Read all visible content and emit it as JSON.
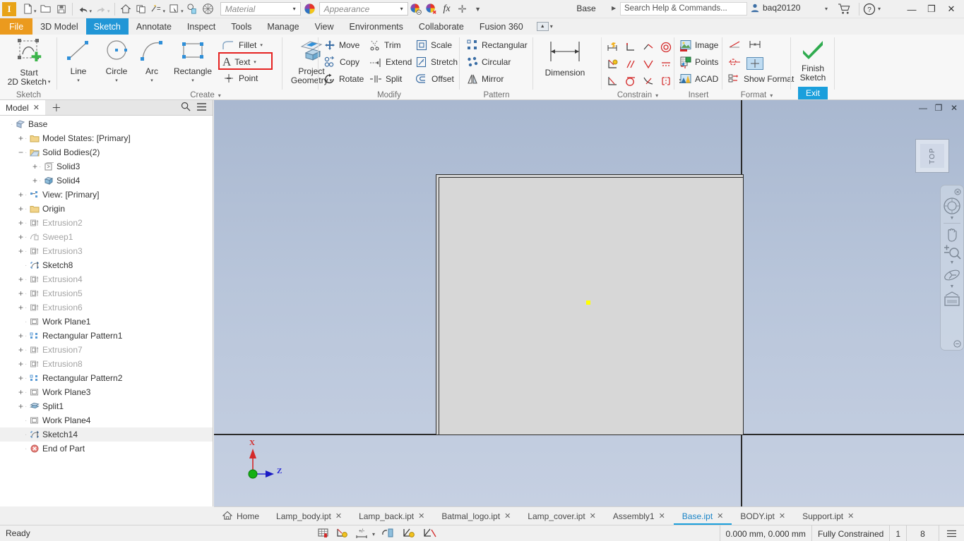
{
  "titlebar": {
    "logo_letter": "I",
    "quick_access": [
      {
        "name": "new-document-icon",
        "label": "New"
      },
      {
        "name": "open-document-icon",
        "label": "Open"
      },
      {
        "name": "save-icon",
        "label": "Save"
      },
      {
        "name": "undo-icon",
        "label": "Undo"
      },
      {
        "name": "redo-icon",
        "label": "Redo"
      },
      {
        "name": "home-icon",
        "label": "Home"
      },
      {
        "name": "return-icon",
        "label": "Return"
      },
      {
        "name": "update-icon",
        "label": "Update"
      },
      {
        "name": "select-icon",
        "label": "Select"
      },
      {
        "name": "parameters-icon",
        "label": "Parameters"
      },
      {
        "name": "material-sphere-icon",
        "label": "Material Sphere"
      }
    ],
    "material_placeholder": "Material",
    "appearance_placeholder": "Appearance",
    "fx_label": "fx",
    "document_title": "Base",
    "search_placeholder": "Search Help & Commands...",
    "user_name": "baq20120",
    "minimize": "—",
    "restore": "❐",
    "close": "✕"
  },
  "ribbon_tabs": [
    {
      "label": "File",
      "state": "file"
    },
    {
      "label": "3D Model",
      "state": "normal"
    },
    {
      "label": "Sketch",
      "state": "active"
    },
    {
      "label": "Annotate",
      "state": "normal"
    },
    {
      "label": "Inspect",
      "state": "normal"
    },
    {
      "label": "Tools",
      "state": "normal"
    },
    {
      "label": "Manage",
      "state": "normal"
    },
    {
      "label": "View",
      "state": "normal"
    },
    {
      "label": "Environments",
      "state": "normal"
    },
    {
      "label": "Collaborate",
      "state": "normal"
    },
    {
      "label": "Fusion 360",
      "state": "normal"
    }
  ],
  "ribbon": {
    "panels": {
      "sketch": {
        "label": "Sketch",
        "start_2d_sketch_line1": "Start",
        "start_2d_sketch_line2": "2D Sketch"
      },
      "create": {
        "label": "Create",
        "line": "Line",
        "circle": "Circle",
        "arc": "Arc",
        "rectangle": "Rectangle",
        "fillet": "Fillet",
        "text": "Text",
        "point": "Point",
        "project_geometry_line1": "Project",
        "project_geometry_line2": "Geometry"
      },
      "modify": {
        "label": "Modify",
        "move": "Move",
        "copy": "Copy",
        "rotate": "Rotate",
        "trim": "Trim",
        "extend": "Extend",
        "split": "Split",
        "scale": "Scale",
        "stretch": "Stretch",
        "offset": "Offset"
      },
      "pattern": {
        "label": "Pattern",
        "rectangular": "Rectangular",
        "circular": "Circular",
        "mirror": "Mirror"
      },
      "constrain": {
        "label": "Constrain",
        "dimension": "Dimension"
      },
      "insert": {
        "label": "Insert",
        "image": "Image",
        "points": "Points",
        "acad": "ACAD"
      },
      "format": {
        "label": "Format",
        "show_format": "Show Format"
      },
      "exit": {
        "finish_sketch_line1": "Finish",
        "finish_sketch_line2": "Sketch",
        "exit": "Exit"
      }
    },
    "highlight_color": "#e52322"
  },
  "browser": {
    "tab_label": "Model",
    "tab_close": "✕",
    "add_tab": "＋",
    "search_icon": "search-icon",
    "menu_icon": "hamburger-icon",
    "tree": [
      {
        "label": "Base",
        "indent": 0,
        "expander": "",
        "icon": "part-icon",
        "dim": false,
        "selected": false
      },
      {
        "label": "Model States: [Primary]",
        "indent": 1,
        "expander": "+",
        "icon": "folder-icon",
        "dim": false,
        "selected": false
      },
      {
        "label": "Solid Bodies(2)",
        "indent": 1,
        "expander": "−",
        "icon": "folder-open-icon",
        "dim": false,
        "selected": false
      },
      {
        "label": "Solid3",
        "indent": 2,
        "expander": "+",
        "icon": "solid-wire-icon",
        "dim": false,
        "selected": false
      },
      {
        "label": "Solid4",
        "indent": 2,
        "expander": "+",
        "icon": "solid-icon",
        "dim": false,
        "selected": false
      },
      {
        "label": "View: [Primary]",
        "indent": 1,
        "expander": "+",
        "icon": "view-icon",
        "dim": false,
        "selected": false
      },
      {
        "label": "Origin",
        "indent": 1,
        "expander": "+",
        "icon": "folder-icon",
        "dim": false,
        "selected": false
      },
      {
        "label": "Extrusion2",
        "indent": 1,
        "expander": "+",
        "icon": "extrusion-icon",
        "dim": true,
        "selected": false
      },
      {
        "label": "Sweep1",
        "indent": 1,
        "expander": "+",
        "icon": "sweep-icon",
        "dim": true,
        "selected": false
      },
      {
        "label": "Extrusion3",
        "indent": 1,
        "expander": "+",
        "icon": "extrusion-icon",
        "dim": true,
        "selected": false
      },
      {
        "label": "Sketch8",
        "indent": 1,
        "expander": "",
        "icon": "sketch-icon",
        "dim": false,
        "selected": false
      },
      {
        "label": "Extrusion4",
        "indent": 1,
        "expander": "+",
        "icon": "extrusion-icon",
        "dim": true,
        "selected": false
      },
      {
        "label": "Extrusion5",
        "indent": 1,
        "expander": "+",
        "icon": "extrusion-icon",
        "dim": true,
        "selected": false
      },
      {
        "label": "Extrusion6",
        "indent": 1,
        "expander": "+",
        "icon": "extrusion-icon",
        "dim": true,
        "selected": false
      },
      {
        "label": "Work Plane1",
        "indent": 1,
        "expander": "",
        "icon": "workplane-icon",
        "dim": false,
        "selected": false
      },
      {
        "label": "Rectangular Pattern1",
        "indent": 1,
        "expander": "+",
        "icon": "rect-pattern-icon",
        "dim": false,
        "selected": false
      },
      {
        "label": "Extrusion7",
        "indent": 1,
        "expander": "+",
        "icon": "extrusion-icon",
        "dim": true,
        "selected": false
      },
      {
        "label": "Extrusion8",
        "indent": 1,
        "expander": "+",
        "icon": "extrusion-icon",
        "dim": true,
        "selected": false
      },
      {
        "label": "Rectangular Pattern2",
        "indent": 1,
        "expander": "+",
        "icon": "rect-pattern-icon",
        "dim": false,
        "selected": false
      },
      {
        "label": "Work Plane3",
        "indent": 1,
        "expander": "+",
        "icon": "workplane-icon",
        "dim": false,
        "selected": false
      },
      {
        "label": "Split1",
        "indent": 1,
        "expander": "+",
        "icon": "split-icon",
        "dim": false,
        "selected": false
      },
      {
        "label": "Work Plane4",
        "indent": 1,
        "expander": "",
        "icon": "workplane-icon",
        "dim": false,
        "selected": false
      },
      {
        "label": "Sketch14",
        "indent": 1,
        "expander": "",
        "icon": "sketch-icon",
        "dim": false,
        "selected": true
      },
      {
        "label": "End of Part",
        "indent": 1,
        "expander": "",
        "icon": "end-of-part-icon",
        "dim": false,
        "selected": false
      }
    ]
  },
  "graphics": {
    "viewcube_label": "TOP",
    "axis_x_label": "X",
    "axis_z_label": "Z",
    "axis_x_color": "#d42a2a",
    "axis_z_color": "#2a2ad4",
    "axis_origin_color": "#14b014",
    "sketch_point_color": "#ffff00",
    "sketch_face_color": "#d7d7d7",
    "background_top_color": "#a9b8d0",
    "background_bottom_color": "#c6d0e2",
    "window_minimize": "—",
    "window_restore": "❐",
    "window_close": "✕",
    "navbar_items": [
      {
        "name": "navbar-close-icon"
      },
      {
        "name": "full-navigation-wheel-icon"
      },
      {
        "name": "navbar-wheel-dropdown-caret"
      },
      {
        "name": "pan-hand-icon"
      },
      {
        "name": "zoom-magnifier-icon"
      },
      {
        "name": "zoom-dropdown-caret"
      },
      {
        "name": "orbit-icon"
      },
      {
        "name": "orbit-dropdown-caret"
      },
      {
        "name": "look-at-icon"
      },
      {
        "name": "navbar-options-icon"
      }
    ]
  },
  "doc_tabs": [
    {
      "label": "Home",
      "closable": false,
      "active": false,
      "icon": "home-icon"
    },
    {
      "label": "Lamp_body.ipt",
      "closable": true,
      "active": false
    },
    {
      "label": "Lamp_back.ipt",
      "closable": true,
      "active": false
    },
    {
      "label": "Batmal_logo.ipt",
      "closable": true,
      "active": false
    },
    {
      "label": "Lamp_cover.ipt",
      "closable": true,
      "active": false
    },
    {
      "label": "Assembly1",
      "closable": true,
      "active": false
    },
    {
      "label": "Base.ipt",
      "closable": true,
      "active": true
    },
    {
      "label": "BODY.ipt",
      "closable": true,
      "active": false
    },
    {
      "label": "Support.ipt",
      "closable": true,
      "active": false
    }
  ],
  "statusbar": {
    "ready": "Ready",
    "coordinates": "0.000 mm, 0.000 mm",
    "constraint_status": "Fully Constrained",
    "dimensions_count": "1",
    "entities_count": "8",
    "icons": [
      {
        "name": "grid-snap-icon"
      },
      {
        "name": "constraint-inference-icon"
      },
      {
        "name": "dimension-input-icon"
      },
      {
        "name": "dimension-input-caret"
      },
      {
        "name": "slice-graphics-icon"
      },
      {
        "name": "show-constraints-icon"
      },
      {
        "name": "relax-mode-icon"
      }
    ],
    "menu_icon": "hamburger-icon"
  }
}
